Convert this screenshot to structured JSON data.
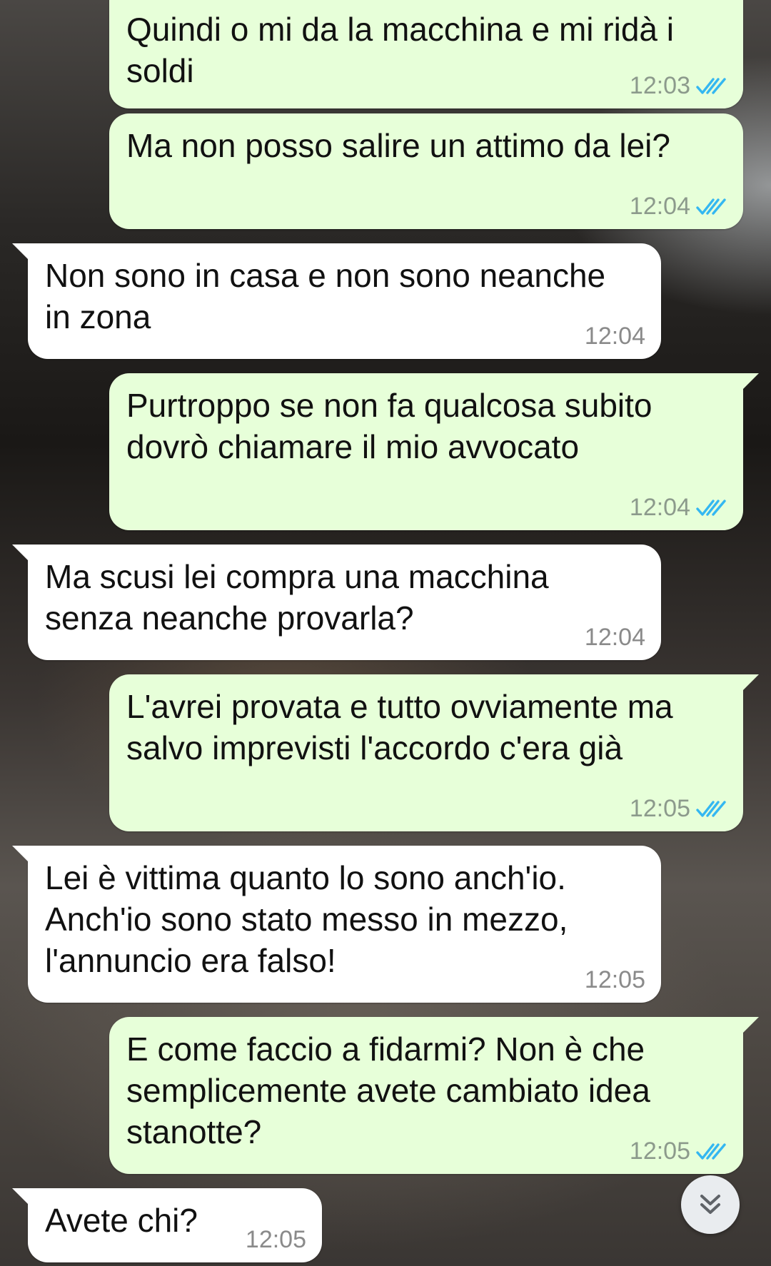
{
  "colors": {
    "outgoing_bubble": "#e7ffd9",
    "incoming_bubble": "#ffffff",
    "read_ticks": "#34b7f1"
  },
  "messages": [
    {
      "direction": "out",
      "text": "Quindi o mi da la macchina e mi ridà i\nsoldi",
      "time": "12:03",
      "status_icon": "double-check-read-icon"
    },
    {
      "direction": "out",
      "text": "Ma non posso salire un attimo da lei?",
      "time": "12:04",
      "status_icon": "double-check-read-icon"
    },
    {
      "direction": "in",
      "text": "Non sono in casa e non sono neanche\nin zona",
      "time": "12:04"
    },
    {
      "direction": "out",
      "text": "Purtroppo se non fa qualcosa subito\ndovrò chiamare il mio avvocato",
      "time": "12:04",
      "status_icon": "double-check-read-icon"
    },
    {
      "direction": "in",
      "text": "Ma scusi lei compra una macchina\nsenza neanche provarla?",
      "time": "12:04"
    },
    {
      "direction": "out",
      "text": "L'avrei provata e tutto ovviamente ma\nsalvo imprevisti l'accordo c'era già",
      "time": "12:05",
      "status_icon": "double-check-read-icon"
    },
    {
      "direction": "in",
      "text": "Lei è vittima quanto lo sono anch'io.\nAnch'io sono stato messo in mezzo,\nl'annuncio era falso!",
      "time": "12:05"
    },
    {
      "direction": "out",
      "text": "E come faccio a fidarmi? Non è che\nsemplicemente avete cambiato idea\nstanotte?",
      "time": "12:05",
      "status_icon": "double-check-read-icon"
    },
    {
      "direction": "in",
      "text": "Avete chi?",
      "time": "12:05"
    }
  ],
  "scroll_button": {
    "icon": "double-chevron-down-icon"
  }
}
